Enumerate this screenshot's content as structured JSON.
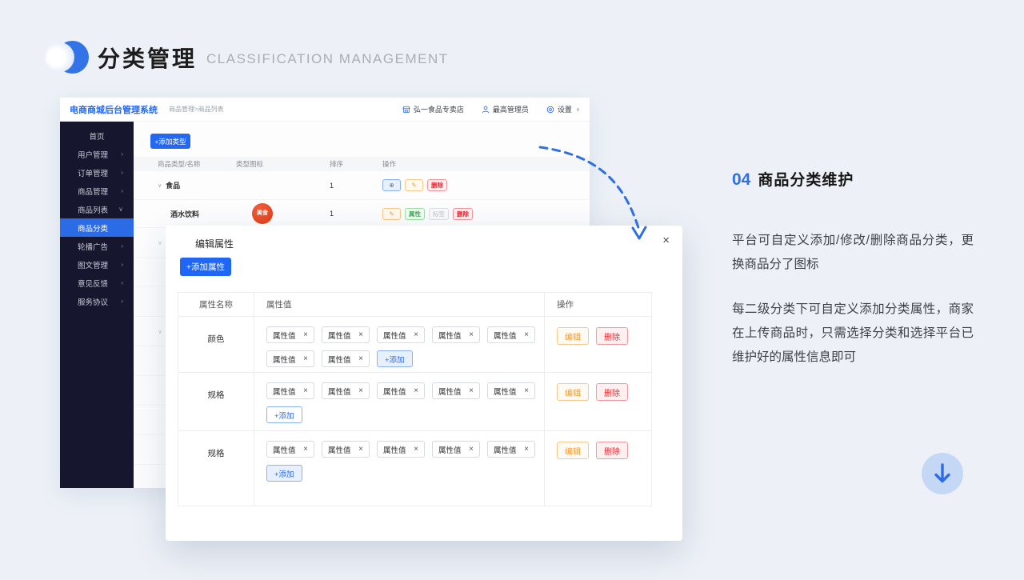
{
  "header": {
    "title_cn": "分类管理",
    "title_en": "CLASSIFICATION MANAGEMENT"
  },
  "admin": {
    "brand": "电商商城后台管理系统",
    "breadcrumb": "商品管理>商品列表",
    "topbar": {
      "store": "弘一食品专卖店",
      "user": "最高管理员",
      "settings": "设置",
      "settings_caret": "∨"
    },
    "sidebar": {
      "items": [
        {
          "label": "首页",
          "arrow": "",
          "active": false
        },
        {
          "label": "用户管理",
          "arrow": "›",
          "active": false
        },
        {
          "label": "订单管理",
          "arrow": "›",
          "active": false
        },
        {
          "label": "商品管理",
          "arrow": "›",
          "active": false
        },
        {
          "label": "商品列表",
          "arrow": "∨",
          "active": false
        },
        {
          "label": "商品分类",
          "arrow": "",
          "active": true
        },
        {
          "label": "轮播广告",
          "arrow": "›",
          "active": false
        },
        {
          "label": "图文管理",
          "arrow": "›",
          "active": false
        },
        {
          "label": "意见反馈",
          "arrow": "›",
          "active": false
        },
        {
          "label": "服务协议",
          "arrow": "›",
          "active": false
        }
      ]
    },
    "content": {
      "add_type_button": "+添加类型",
      "table": {
        "headers": [
          "商品类型/名称",
          "类型图标",
          "排序",
          "操作"
        ],
        "rows": [
          {
            "expand": "∨",
            "name": "食品",
            "icon": "",
            "sort": "1",
            "actions": [
              {
                "label": "⊕",
                "type": "blue"
              },
              {
                "label": "✎",
                "type": "orange"
              },
              {
                "label": "删除",
                "type": "red"
              }
            ]
          },
          {
            "expand": "",
            "name": "酒水饮料",
            "icon": "美食",
            "sort": "1",
            "actions": [
              {
                "label": "✎",
                "type": "orange"
              },
              {
                "label": "属性",
                "type": "green"
              },
              {
                "label": "标签",
                "type": "gray"
              },
              {
                "label": "删除",
                "type": "red"
              }
            ]
          }
        ],
        "hidden_rows": [
          {
            "chev": "∨"
          },
          {
            "chev": ""
          },
          {
            "chev": ""
          },
          {
            "chev": "∨"
          },
          {
            "chev": ""
          },
          {
            "chev": ""
          },
          {
            "chev": ""
          },
          {
            "chev": ""
          }
        ]
      }
    }
  },
  "modal": {
    "title": "编辑属性",
    "close_icon": "×",
    "add_attr_button": "+添加属性",
    "table": {
      "headers": [
        "属性名称",
        "属性值",
        "操作"
      ],
      "tag_label": "属性值",
      "tag_remove_icon": "×",
      "add_tag_label": "+添加",
      "action_edit": "编辑",
      "action_delete": "删除",
      "rows": [
        {
          "name": "颜色",
          "tag_count": 7,
          "add_style": "fill",
          "height": "h1"
        },
        {
          "name": "规格",
          "tag_count": 5,
          "add_style": "outline",
          "height": "h2"
        },
        {
          "name": "规格",
          "tag_count": 5,
          "add_style": "fill",
          "height": "h3"
        }
      ]
    }
  },
  "aside": {
    "number": "04",
    "heading": "商品分类维护",
    "paragraph1": "平台可自定义添加/修改/删除商品分类，更换商品分了图标",
    "paragraph2": "每二级分类下可自定义添加分类属性，商家在上传商品时，只需选择分类和选择平台已维护好的属性信息即可"
  },
  "colors": {
    "accent": "#2468f2",
    "sidebar_bg": "#16162f",
    "sidebar_active": "#2b6ce6",
    "danger": "#f5222d",
    "warning": "#f59a23",
    "success": "#3eb354",
    "arrow_blue": "#2f6fe4"
  }
}
